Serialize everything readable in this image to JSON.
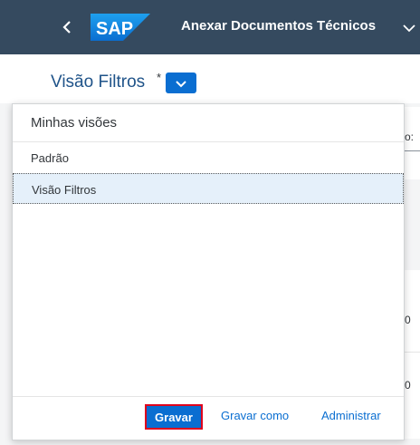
{
  "shell": {
    "logo_text": "SAP",
    "app_title": "Anexar Documentos Técnicos"
  },
  "header": {
    "variant_title": "Visão Filtros",
    "modified_marker": "*"
  },
  "background": {
    "partial_label": "o:",
    "partial_value_1": "0",
    "partial_value_2": "0"
  },
  "popover": {
    "title": "Minhas visões",
    "items": [
      {
        "label": "Padrão",
        "selected": false
      },
      {
        "label": "Visão Filtros",
        "selected": true
      }
    ],
    "footer": {
      "save_label": "Gravar",
      "save_as_label": "Gravar como",
      "manage_label": "Administrar"
    }
  },
  "colors": {
    "shell_bar": "#354a5f",
    "accent": "#0a6ed1",
    "highlight_box": "#e0001c"
  }
}
